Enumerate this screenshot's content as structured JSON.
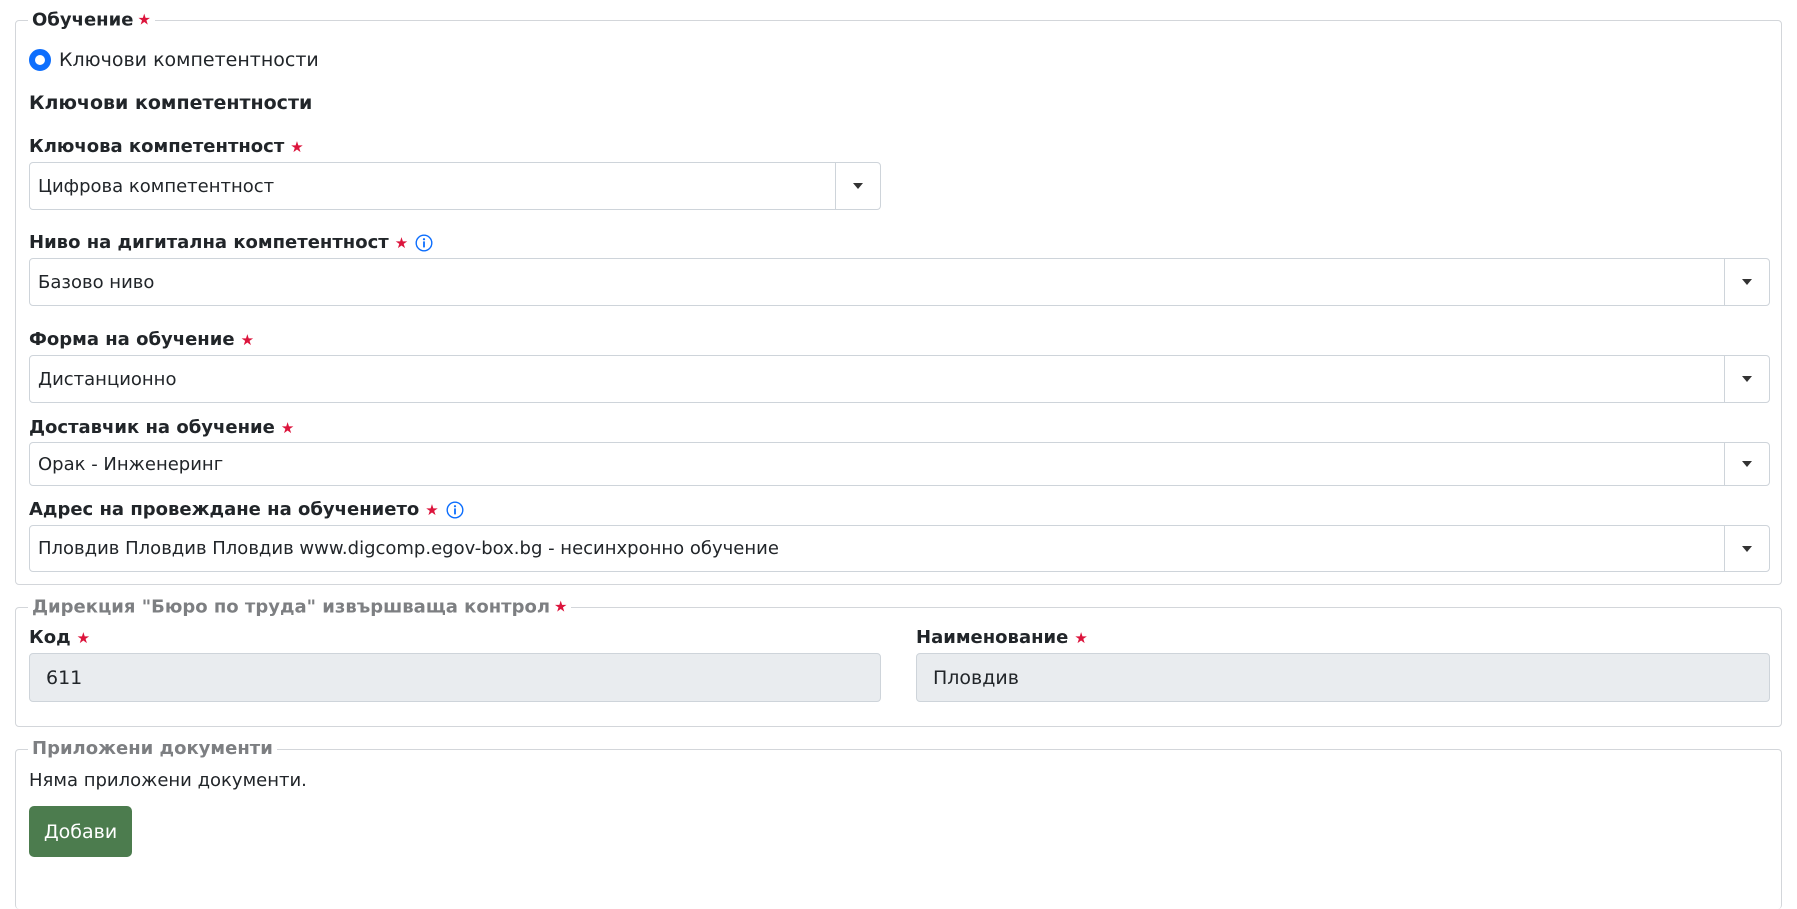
{
  "training": {
    "legend": "Обучение",
    "radio_label": "Ключови компетентности",
    "subheading": "Ключови компетентности",
    "key_competence": {
      "label": "Ключова компетентност",
      "value": "Цифрова компетентност"
    },
    "digital_level": {
      "label": "Ниво на дигитална компетентност",
      "value": "Базово ниво"
    },
    "training_form": {
      "label": "Форма на обучение",
      "value": "Дистанционно"
    },
    "provider": {
      "label": "Доставчик на обучение",
      "value": "Орак - Инженеринг"
    },
    "address": {
      "label": "Адрес на провеждане на обучението",
      "value": "Пловдив Пловдив Пловдив www.digcomp.egov-box.bg - несинхронно обучение"
    }
  },
  "directorate": {
    "legend": "Дирекция \"Бюро по труда\" извършваща контрол",
    "code": {
      "label": "Код",
      "value": "611"
    },
    "name": {
      "label": "Наименование",
      "value": "Пловдив"
    }
  },
  "documents": {
    "legend": "Приложени документи",
    "empty_text": "Няма приложени документи.",
    "add_label": "Добави"
  },
  "required_mark": "★",
  "colors": {
    "required": "#dc143c",
    "primary": "#0d6efd",
    "add_button": "#4c7c4e",
    "readonly_bg": "#e9ecef"
  },
  "icons": {
    "info": "info-circle-icon",
    "dropdown": "caret-down-icon",
    "radio": "radio-selected-icon"
  }
}
